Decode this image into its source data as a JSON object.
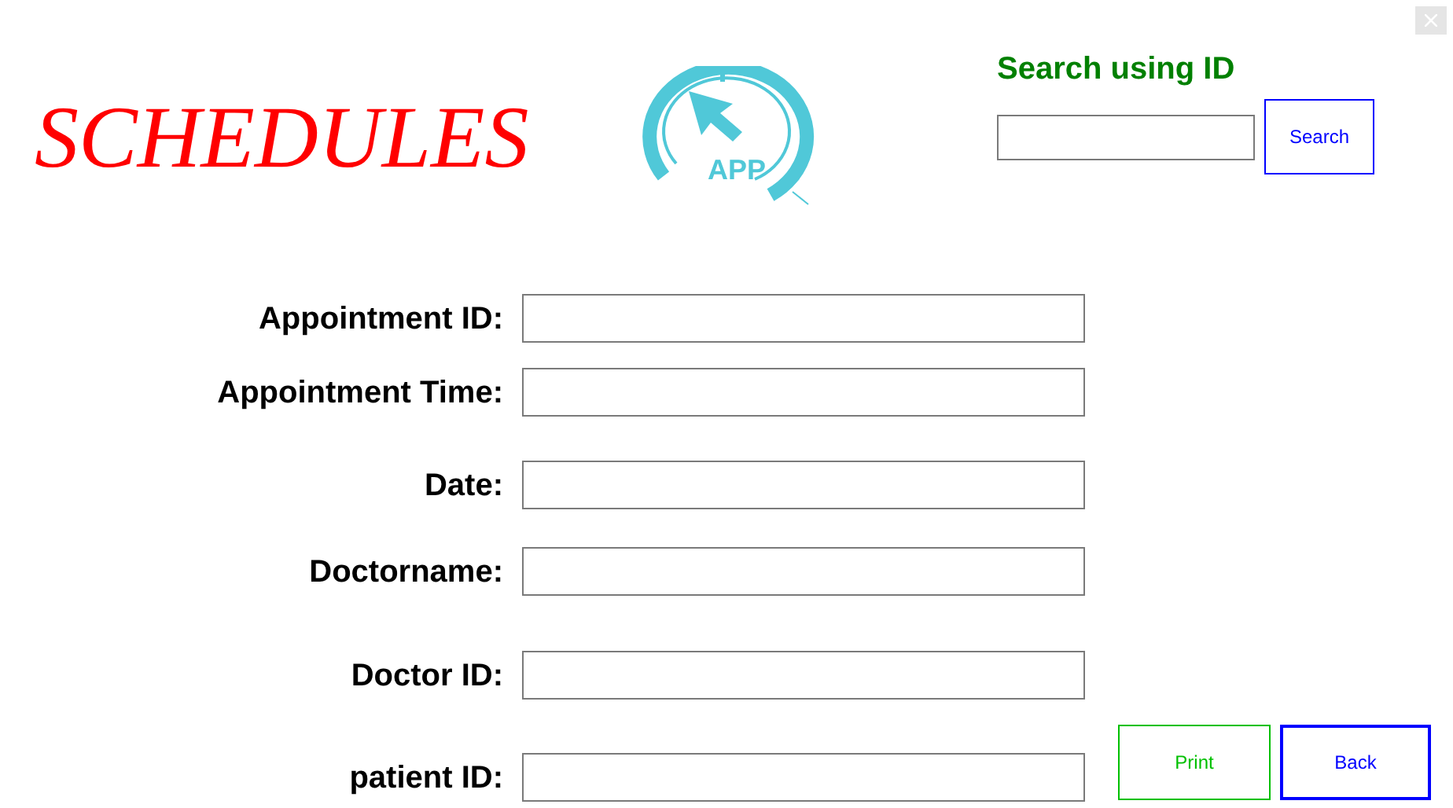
{
  "title": "SCHEDULES",
  "logo": {
    "text": "APP"
  },
  "search": {
    "heading": "Search using ID",
    "button": "Search"
  },
  "fields": [
    {
      "label": "Appointment ID:"
    },
    {
      "label": "Appointment Time:"
    },
    {
      "label": "Date:"
    },
    {
      "label": "Doctorname:"
    },
    {
      "label": "Doctor ID:"
    },
    {
      "label": "patient ID:"
    }
  ],
  "buttons": [
    {
      "label": "Print",
      "kind": "print"
    },
    {
      "label": "Back",
      "kind": "back"
    }
  ]
}
